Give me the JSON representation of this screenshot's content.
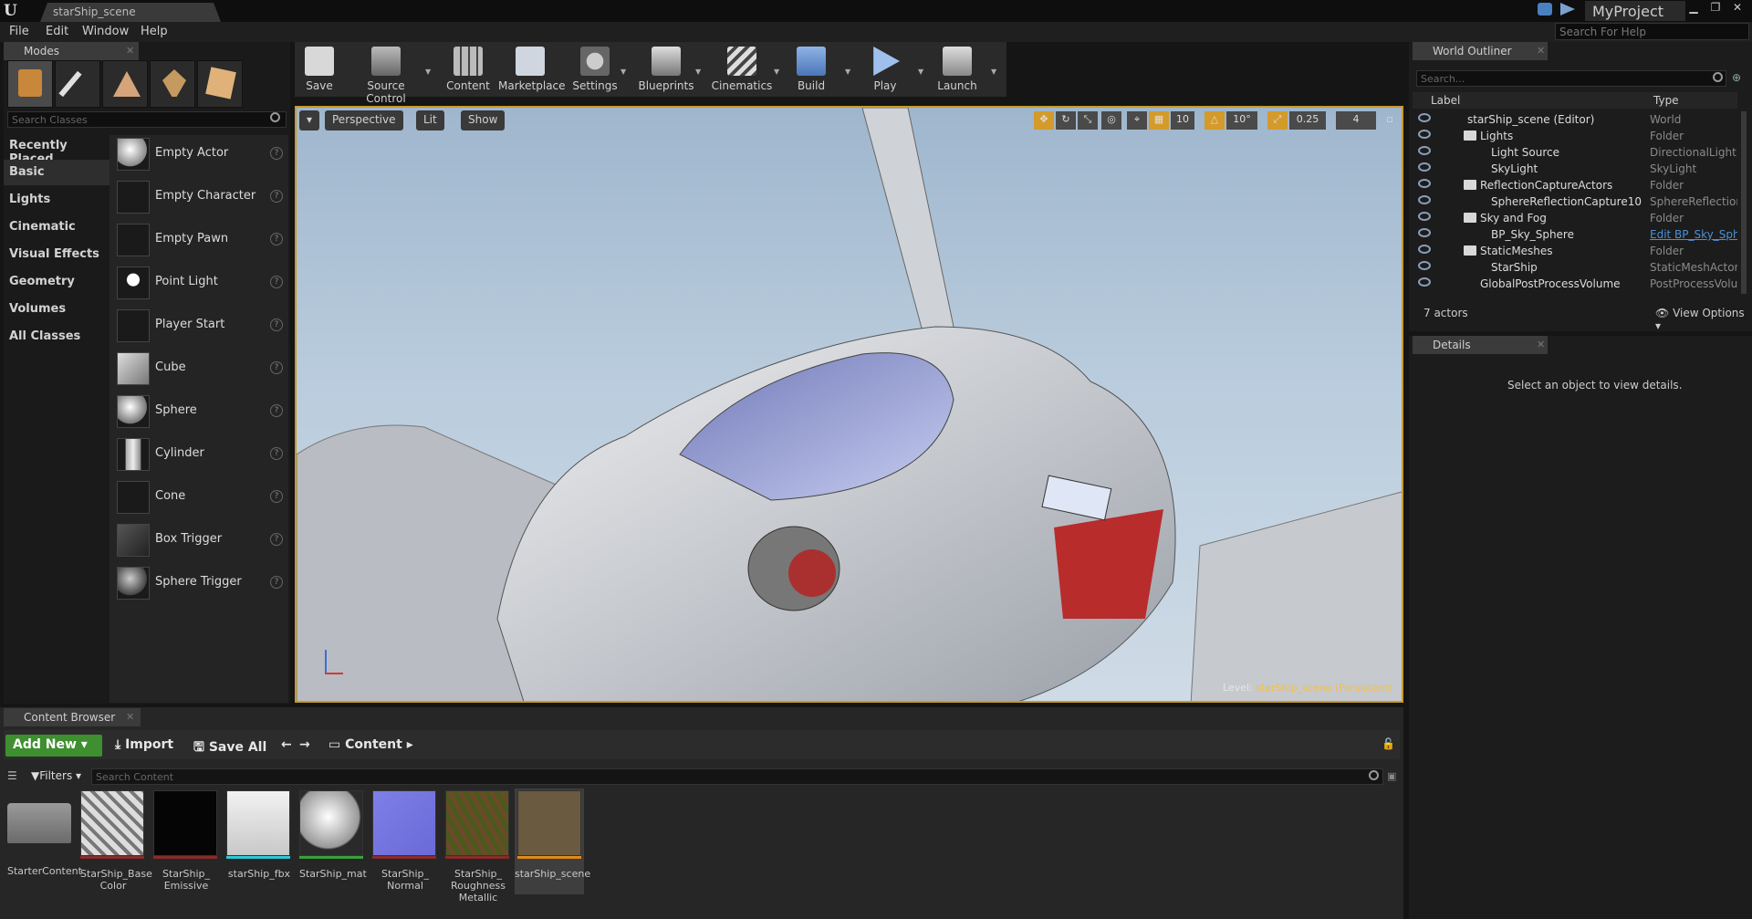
{
  "titlebar": {
    "tab": "starShip_scene",
    "project": "MyProject"
  },
  "menu": {
    "items": [
      "File",
      "Edit",
      "Window",
      "Help"
    ],
    "search_placeholder": "Search For Help"
  },
  "modes": {
    "tab": "Modes",
    "search_placeholder": "Search Classes",
    "categories": [
      "Recently Placed",
      "Basic",
      "Lights",
      "Cinematic",
      "Visual Effects",
      "Geometry",
      "Volumes",
      "All Classes"
    ],
    "actors": [
      "Empty Actor",
      "Empty Character",
      "Empty Pawn",
      "Point Light",
      "Player Start",
      "Cube",
      "Sphere",
      "Cylinder",
      "Cone",
      "Box Trigger",
      "Sphere Trigger"
    ]
  },
  "toolbar": {
    "buttons": [
      "Save",
      "Source Control",
      "Content",
      "Marketplace",
      "Settings",
      "Blueprints",
      "Cinematics",
      "Build",
      "Play",
      "Launch"
    ]
  },
  "viewport": {
    "perspective": "Perspective",
    "lit": "Lit",
    "show": "Show",
    "grid_snap": "10",
    "rot_snap": "10°",
    "scale_snap": "0.25",
    "cam_speed": "4",
    "level_prefix": "Level:",
    "level_name": "starShip_scene (Persistent)"
  },
  "outliner": {
    "tab": "World Outliner",
    "search_placeholder": "Search...",
    "col_label": "Label",
    "col_type": "Type",
    "rows": [
      {
        "label": "starShip_scene (Editor)",
        "type": "World"
      },
      {
        "label": "Lights",
        "type": "Folder"
      },
      {
        "label": "Light Source",
        "type": "DirectionalLight"
      },
      {
        "label": "SkyLight",
        "type": "SkyLight"
      },
      {
        "label": "ReflectionCaptureActors",
        "type": "Folder"
      },
      {
        "label": "SphereReflectionCapture10",
        "type": "SphereReflectionC"
      },
      {
        "label": "Sky and Fog",
        "type": "Folder"
      },
      {
        "label": "BP_Sky_Sphere",
        "type": "Edit BP_Sky_Sph"
      },
      {
        "label": "StaticMeshes",
        "type": "Folder"
      },
      {
        "label": "StarShip",
        "type": "StaticMeshActor"
      },
      {
        "label": "GlobalPostProcessVolume",
        "type": "PostProcessVolun"
      }
    ],
    "actor_count": "7 actors",
    "view_options": "View Options"
  },
  "details": {
    "tab": "Details",
    "empty_message": "Select an object to view details."
  },
  "content_browser": {
    "tab": "Content Browser",
    "add_new": "Add New",
    "import": "Import",
    "save_all": "Save All",
    "path": "Content",
    "filters": "Filters",
    "search_placeholder": "Search Content",
    "assets": [
      {
        "label": "StarterContent",
        "color": "#777777"
      },
      {
        "label": "StarShip_Base Color",
        "color": "#8a2a2a"
      },
      {
        "label": "StarShip_ Emissive",
        "color": "#8a2a2a"
      },
      {
        "label": "starShip_fbx",
        "color": "#2ac8d8"
      },
      {
        "label": "StarShip_mat",
        "color": "#3aa03a"
      },
      {
        "label": "StarShip_ Normal",
        "color": "#8a2a2a"
      },
      {
        "label": "StarShip_ Roughness Metallic",
        "color": "#8a2a2a"
      },
      {
        "label": "starShip_scene",
        "color": "#e08a1a"
      }
    ]
  }
}
